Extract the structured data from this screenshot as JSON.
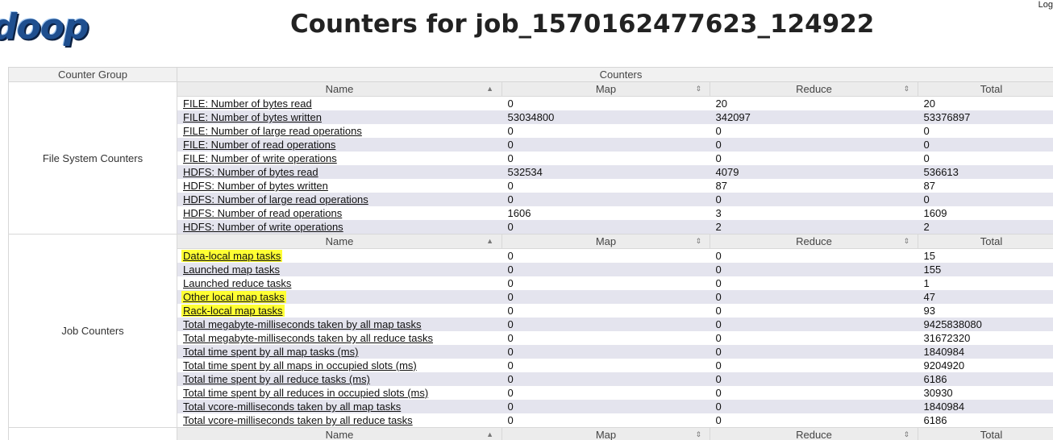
{
  "header": {
    "logo_text": "doop",
    "title": "Counters for job_1570162477623_124922",
    "login_text": "Log"
  },
  "table": {
    "group_header": "Counter Group",
    "counters_header": "Counters",
    "columns": {
      "name": "Name",
      "map": "Map",
      "reduce": "Reduce",
      "total": "Total"
    },
    "groups": [
      {
        "name": "File System Counters",
        "rows": [
          {
            "name": "FILE: Number of bytes read",
            "map": "0",
            "reduce": "20",
            "total": "20",
            "highlight": false
          },
          {
            "name": "FILE: Number of bytes written",
            "map": "53034800",
            "reduce": "342097",
            "total": "53376897",
            "highlight": false
          },
          {
            "name": "FILE: Number of large read operations",
            "map": "0",
            "reduce": "0",
            "total": "0",
            "highlight": false
          },
          {
            "name": "FILE: Number of read operations",
            "map": "0",
            "reduce": "0",
            "total": "0",
            "highlight": false
          },
          {
            "name": "FILE: Number of write operations",
            "map": "0",
            "reduce": "0",
            "total": "0",
            "highlight": false
          },
          {
            "name": "HDFS: Number of bytes read",
            "map": "532534",
            "reduce": "4079",
            "total": "536613",
            "highlight": false
          },
          {
            "name": "HDFS: Number of bytes written",
            "map": "0",
            "reduce": "87",
            "total": "87",
            "highlight": false
          },
          {
            "name": "HDFS: Number of large read operations",
            "map": "0",
            "reduce": "0",
            "total": "0",
            "highlight": false
          },
          {
            "name": "HDFS: Number of read operations",
            "map": "1606",
            "reduce": "3",
            "total": "1609",
            "highlight": false
          },
          {
            "name": "HDFS: Number of write operations",
            "map": "0",
            "reduce": "2",
            "total": "2",
            "highlight": false
          }
        ]
      },
      {
        "name": "Job Counters",
        "rows": [
          {
            "name": "Data-local map tasks",
            "map": "0",
            "reduce": "0",
            "total": "15",
            "highlight": true
          },
          {
            "name": "Launched map tasks",
            "map": "0",
            "reduce": "0",
            "total": "155",
            "highlight": false
          },
          {
            "name": "Launched reduce tasks",
            "map": "0",
            "reduce": "0",
            "total": "1",
            "highlight": false
          },
          {
            "name": "Other local map tasks",
            "map": "0",
            "reduce": "0",
            "total": "47",
            "highlight": true
          },
          {
            "name": "Rack-local map tasks",
            "map": "0",
            "reduce": "0",
            "total": "93",
            "highlight": true
          },
          {
            "name": "Total megabyte-milliseconds taken by all map tasks",
            "map": "0",
            "reduce": "0",
            "total": "9425838080",
            "highlight": false
          },
          {
            "name": "Total megabyte-milliseconds taken by all reduce tasks",
            "map": "0",
            "reduce": "0",
            "total": "31672320",
            "highlight": false
          },
          {
            "name": "Total time spent by all map tasks (ms)",
            "map": "0",
            "reduce": "0",
            "total": "1840984",
            "highlight": false
          },
          {
            "name": "Total time spent by all maps in occupied slots (ms)",
            "map": "0",
            "reduce": "0",
            "total": "9204920",
            "highlight": false
          },
          {
            "name": "Total time spent by all reduce tasks (ms)",
            "map": "0",
            "reduce": "0",
            "total": "6186",
            "highlight": false
          },
          {
            "name": "Total time spent by all reduces in occupied slots (ms)",
            "map": "0",
            "reduce": "0",
            "total": "30930",
            "highlight": false
          },
          {
            "name": "Total vcore-milliseconds taken by all map tasks",
            "map": "0",
            "reduce": "0",
            "total": "1840984",
            "highlight": false
          },
          {
            "name": "Total vcore-milliseconds taken by all reduce tasks",
            "map": "0",
            "reduce": "0",
            "total": "6186",
            "highlight": false
          }
        ]
      },
      {
        "name": "",
        "rows": []
      }
    ]
  },
  "icons": {
    "sort_asc": "▲",
    "sort_both": "⇕"
  },
  "colors": {
    "highlight": "#ffff33",
    "row_alt": "#e4e4ee",
    "header_bg": "#f1f1f1"
  }
}
